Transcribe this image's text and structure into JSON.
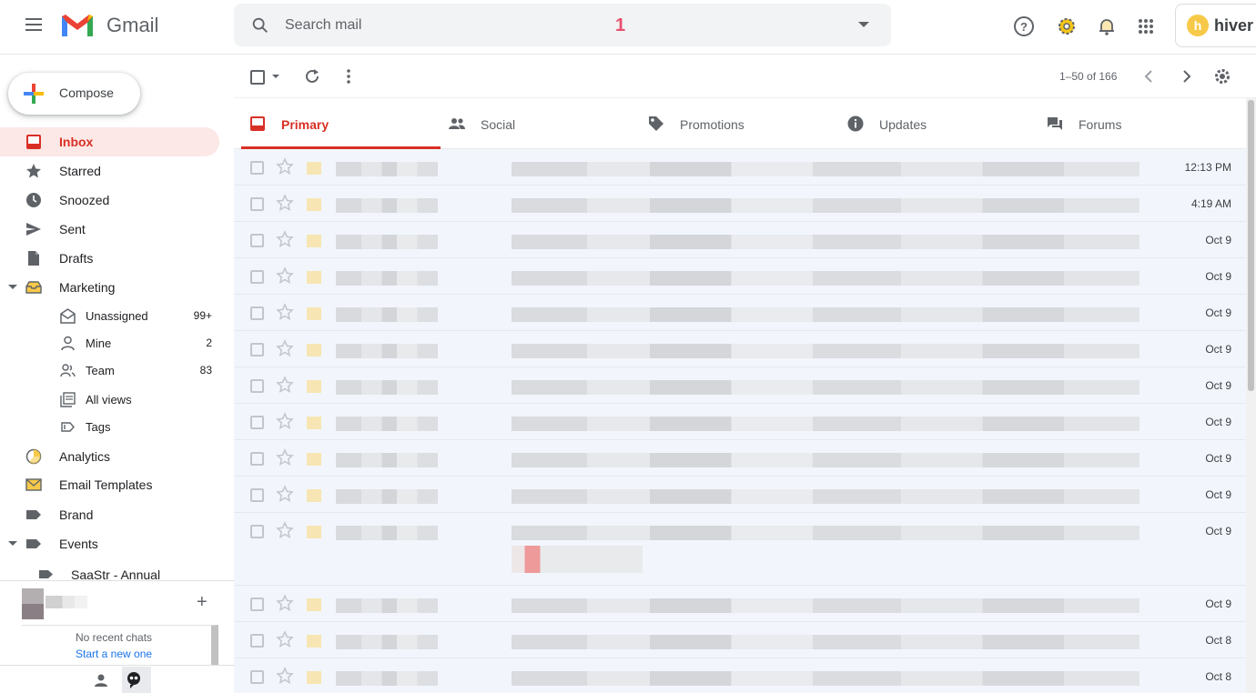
{
  "app": {
    "name": "Gmail"
  },
  "search": {
    "placeholder": "Search mail",
    "badge": "1"
  },
  "hiver": {
    "brand": "hiver",
    "logo_letter": "h"
  },
  "compose": {
    "label": "Compose"
  },
  "sidebar": {
    "items": [
      {
        "label": "Inbox",
        "icon": "inbox-icon",
        "active": true
      },
      {
        "label": "Starred",
        "icon": "star-icon"
      },
      {
        "label": "Snoozed",
        "icon": "clock-icon"
      },
      {
        "label": "Sent",
        "icon": "send-icon"
      },
      {
        "label": "Drafts",
        "icon": "draft-icon"
      },
      {
        "label": "Marketing",
        "icon": "shared-inbox-icon"
      }
    ],
    "marketing_sub": [
      {
        "label": "Unassigned",
        "count": "99+",
        "icon": "unassigned-icon"
      },
      {
        "label": "Mine",
        "count": "2",
        "icon": "person-icon"
      },
      {
        "label": "Team",
        "count": "83",
        "icon": "team-icon"
      },
      {
        "label": "All views",
        "count": "",
        "icon": "views-icon"
      },
      {
        "label": "Tags",
        "count": "",
        "icon": "tag-icon"
      }
    ],
    "lower": [
      {
        "label": "Analytics",
        "icon": "analytics-icon"
      },
      {
        "label": "Email Templates",
        "icon": "email-template-icon"
      },
      {
        "label": "Brand",
        "icon": "label-icon"
      },
      {
        "label": "Events",
        "icon": "label-icon"
      }
    ],
    "events_sub": {
      "label": "SaaStr - Annual"
    }
  },
  "hangouts": {
    "no_chats": "No recent chats",
    "start_new": "Start a new one"
  },
  "toolbar": {
    "page_info": "1–50 of 166"
  },
  "tabs": [
    {
      "label": "Primary",
      "icon": "inbox-icon",
      "active": true
    },
    {
      "label": "Social",
      "icon": "people-icon"
    },
    {
      "label": "Promotions",
      "icon": "tag-icon"
    },
    {
      "label": "Updates",
      "icon": "info-icon"
    },
    {
      "label": "Forums",
      "icon": "forum-icon"
    }
  ],
  "emails": [
    {
      "date": "12:13 PM"
    },
    {
      "date": "4:19 AM"
    },
    {
      "date": "Oct 9"
    },
    {
      "date": "Oct 9"
    },
    {
      "date": "Oct 9"
    },
    {
      "date": "Oct 9"
    },
    {
      "date": "Oct 9"
    },
    {
      "date": "Oct 9"
    },
    {
      "date": "Oct 9"
    },
    {
      "date": "Oct 9"
    },
    {
      "date": "Oct 9"
    },
    {
      "date": "Oct 9"
    },
    {
      "date": "Oct 8"
    },
    {
      "date": "Oct 8"
    }
  ],
  "colors": {
    "accent": "#d93025",
    "active_bg": "#fce8e6",
    "row_bg": "#f2f6fc"
  }
}
